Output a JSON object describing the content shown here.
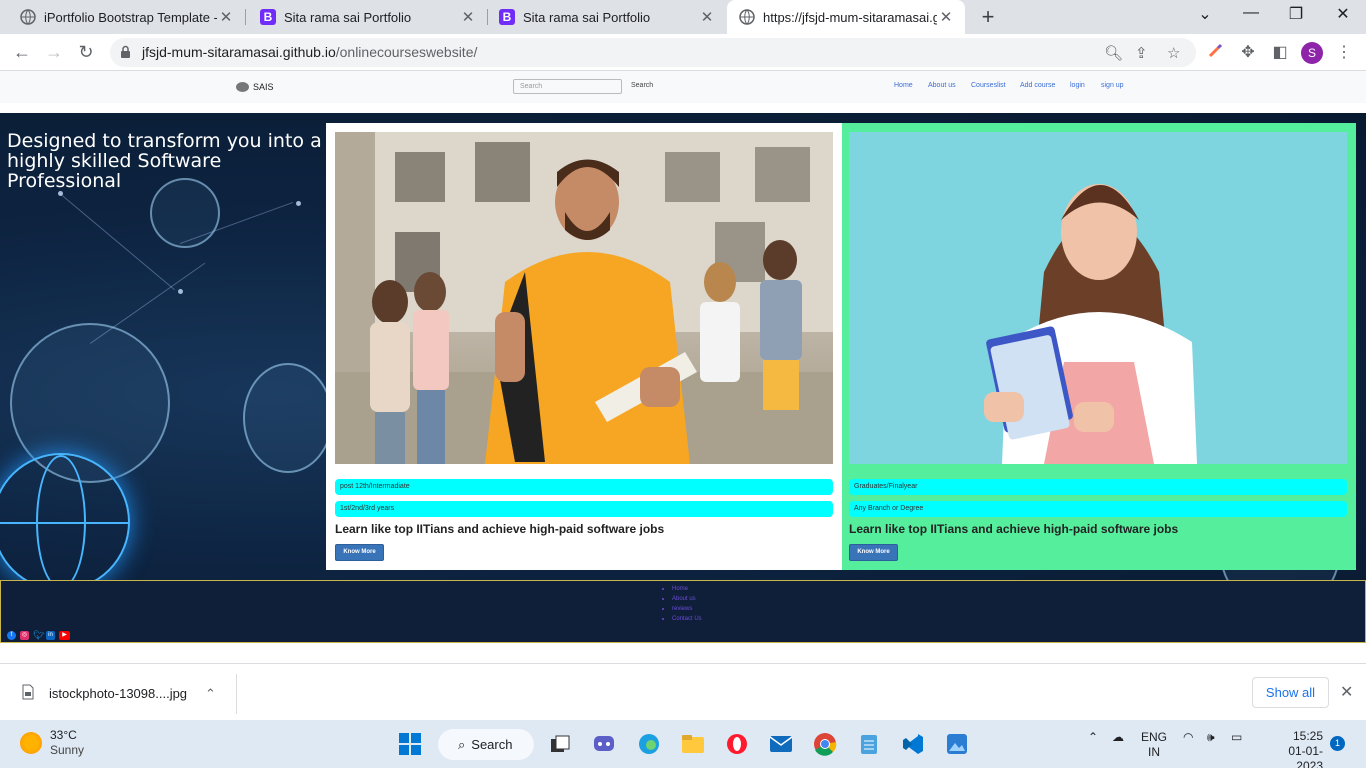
{
  "tabs": [
    {
      "title": "iPortfolio Bootstrap Template - In",
      "icon": "globe-icon"
    },
    {
      "title": "Sita rama sai Portfolio",
      "icon": "bootstrap-icon"
    },
    {
      "title": "Sita rama sai Portfolio",
      "icon": "bootstrap-icon"
    },
    {
      "title": "https://jfsjd-mum-sitaramasai.git",
      "icon": "globe-icon"
    }
  ],
  "address": {
    "host": "jfsjd-mum-sitaramasai.github.io",
    "path": "/onlinecourseswebsite/"
  },
  "profile_initial": "S",
  "site": {
    "brand": "SAIS",
    "search_placeholder": "Search",
    "search_button": "Search",
    "nav": [
      "Home",
      "About us",
      "Courseslist",
      "Add course",
      "login",
      "sign up"
    ]
  },
  "hero": {
    "heading": "Designed to transform you into a highly skilled Software Professional"
  },
  "cards": [
    {
      "tag1": "post 12th/Intermadiate",
      "tag2": "1st/2nd/3rd years",
      "title": "Learn like top IITians and achieve high-paid software jobs",
      "button": "Know More"
    },
    {
      "tag1": "Graduates/Finalyear",
      "tag2": "Any Branch or Degree",
      "title": "Learn like top IITians and achieve high-paid software jobs",
      "button": "Know More"
    }
  ],
  "footer": {
    "links": [
      "Home",
      "About us",
      "reviews",
      "Contact Us"
    ],
    "social": [
      "facebook-icon",
      "instagram-icon",
      "twitter-icon",
      "linkedin-icon",
      "youtube-icon"
    ]
  },
  "download": {
    "filename": "istockphoto-13098....jpg",
    "show_all": "Show all"
  },
  "taskbar": {
    "weather_temp": "33°C",
    "weather_desc": "Sunny",
    "search_label": "Search",
    "lang": "ENG",
    "region": "IN",
    "time": "15:25",
    "date": "01-01-2023",
    "notifications": "1"
  },
  "colors": {
    "accent": "#3a74b8",
    "card_green": "#54ee9d",
    "pill": "#00ffff",
    "footer_bg": "#0f1f39"
  }
}
